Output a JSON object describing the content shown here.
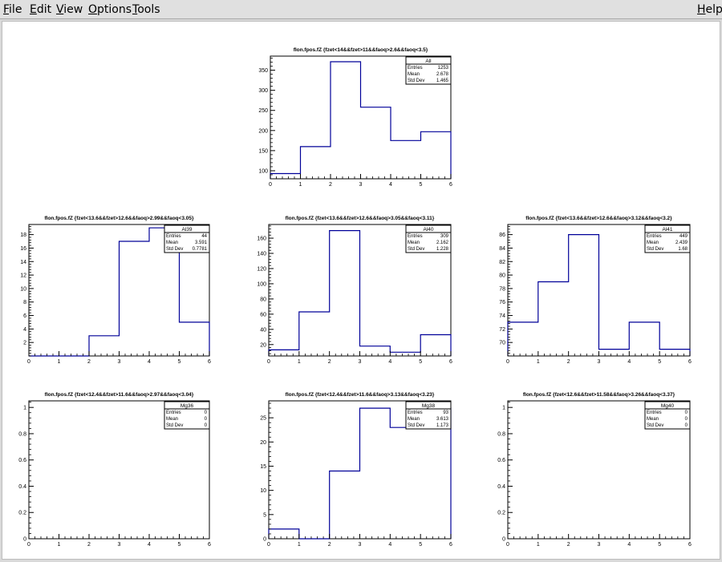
{
  "menu": {
    "items": [
      {
        "pre": "",
        "u": "F",
        "post": "ile"
      },
      {
        "pre": "",
        "u": "E",
        "post": "dit"
      },
      {
        "pre": "",
        "u": "V",
        "post": "iew"
      },
      {
        "pre": "",
        "u": "O",
        "post": "ptions"
      },
      {
        "pre": "",
        "u": "T",
        "post": "ools"
      }
    ],
    "help": {
      "pre": "",
      "u": "H",
      "post": "elp"
    }
  },
  "stats_labels": {
    "entries": "Entries",
    "mean": "Mean",
    "std": "Std Dev"
  },
  "chart_data": [
    {
      "type": "bar",
      "title": "fIon.fpos.fZ {fzet<14&&fzet>11&&faoq>2.6&&faoq<3.5}",
      "stats": {
        "name": "All",
        "entries": "1253",
        "mean": "2.678",
        "std": "1.465"
      },
      "bin_edges": [
        0,
        1,
        2,
        3,
        4,
        5,
        6
      ],
      "values": [
        93,
        160,
        371,
        258,
        175,
        197
      ],
      "xlim": [
        0,
        6
      ],
      "ylim": [
        80,
        385
      ],
      "yticks": [
        100,
        150,
        200,
        250,
        300,
        350
      ],
      "xticks": [
        0,
        1,
        2,
        3,
        4,
        5,
        6
      ],
      "xlabel": "",
      "ylabel": ""
    },
    {
      "type": "bar",
      "title": "fIon.fpos.fZ {fzet<13.6&&fzet>12.6&&faoq>2.99&&faoq<3.05}",
      "stats": {
        "name": "Al39",
        "entries": "44",
        "mean": "3.591",
        "std": "0.7781"
      },
      "bin_edges": [
        0,
        1,
        2,
        3,
        4,
        5,
        6
      ],
      "values": [
        0,
        0,
        3,
        17,
        19,
        5
      ],
      "xlim": [
        0,
        6
      ],
      "ylim": [
        0,
        19.5
      ],
      "yticks": [
        2,
        4,
        6,
        8,
        10,
        12,
        14,
        16,
        18
      ],
      "xticks": [
        0,
        1,
        2,
        3,
        4,
        5,
        6
      ],
      "xlabel": "",
      "ylabel": ""
    },
    {
      "type": "bar",
      "title": "fIon.fpos.fZ {fzet<13.6&&fzet>12.6&&faoq>3.05&&faoq<3.11}",
      "stats": {
        "name": "Al40",
        "entries": "309",
        "mean": "2.162",
        "std": "1.228"
      },
      "bin_edges": [
        0,
        1,
        2,
        3,
        4,
        5,
        6
      ],
      "values": [
        13,
        63,
        170,
        18,
        10,
        33
      ],
      "xlim": [
        0,
        6
      ],
      "ylim": [
        5,
        178
      ],
      "yticks": [
        20,
        40,
        60,
        80,
        100,
        120,
        140,
        160
      ],
      "xticks": [
        0,
        1,
        2,
        3,
        4,
        5,
        6
      ],
      "xlabel": "",
      "ylabel": ""
    },
    {
      "type": "bar",
      "title": "fIon.fpos.fZ {fzet<13.6&&fzet>12.6&&faoq>3.12&&faoq<3.2}",
      "stats": {
        "name": "Al41",
        "entries": "449",
        "mean": "2.439",
        "std": "1.68"
      },
      "bin_edges": [
        0,
        1,
        2,
        3,
        4,
        5,
        6
      ],
      "values": [
        73,
        79,
        86,
        69,
        73,
        69
      ],
      "xlim": [
        0,
        6
      ],
      "ylim": [
        68,
        87.5
      ],
      "yticks": [
        70,
        72,
        74,
        76,
        78,
        80,
        82,
        84,
        86
      ],
      "xticks": [
        0,
        1,
        2,
        3,
        4,
        5,
        6
      ],
      "xlabel": "",
      "ylabel": ""
    },
    {
      "type": "bar",
      "title": "fIon.fpos.fZ {fzet<12.4&&fzet>11.6&&faoq>2.97&&faoq<3.04}",
      "stats": {
        "name": "Mg36",
        "entries": "0",
        "mean": "0",
        "std": "0"
      },
      "bin_edges": [
        0,
        1,
        2,
        3,
        4,
        5,
        6
      ],
      "values": [],
      "xlim": [
        0,
        6
      ],
      "ylim": [
        0,
        1.05
      ],
      "yticks": [
        0,
        0.2,
        0.4,
        0.6,
        0.8,
        1
      ],
      "xticks": [
        0,
        1,
        2,
        3,
        4,
        5,
        6
      ],
      "xlabel": "",
      "ylabel": ""
    },
    {
      "type": "bar",
      "title": "fIon.fpos.fZ {fzet<12.4&&fzet>11.6&&faoq>3.13&&faoq<3.23}",
      "stats": {
        "name": "Mg38",
        "entries": "93",
        "mean": "3.613",
        "std": "1.173"
      },
      "bin_edges": [
        0,
        1,
        2,
        3,
        4,
        5,
        6
      ],
      "values": [
        2,
        0,
        14,
        27,
        23,
        27
      ],
      "xlim": [
        0,
        6
      ],
      "ylim": [
        0,
        28.5
      ],
      "yticks": [
        0,
        5,
        10,
        15,
        20,
        25
      ],
      "xticks": [
        0,
        1,
        2,
        3,
        4,
        5,
        6
      ],
      "xlabel": "",
      "ylabel": ""
    },
    {
      "type": "bar",
      "title": "fIon.fpos.fZ {fzet<12.6&&fzet>11.58&&faoq>3.26&&faoq<3.37}",
      "stats": {
        "name": "Mg40",
        "entries": "0",
        "mean": "0",
        "std": "0"
      },
      "bin_edges": [
        0,
        1,
        2,
        3,
        4,
        5,
        6
      ],
      "values": [],
      "xlim": [
        0,
        6
      ],
      "ylim": [
        0,
        1.05
      ],
      "yticks": [
        0,
        0.2,
        0.4,
        0.6,
        0.8,
        1
      ],
      "xticks": [
        0,
        1,
        2,
        3,
        4,
        5,
        6
      ],
      "xlabel": "",
      "ylabel": ""
    }
  ]
}
